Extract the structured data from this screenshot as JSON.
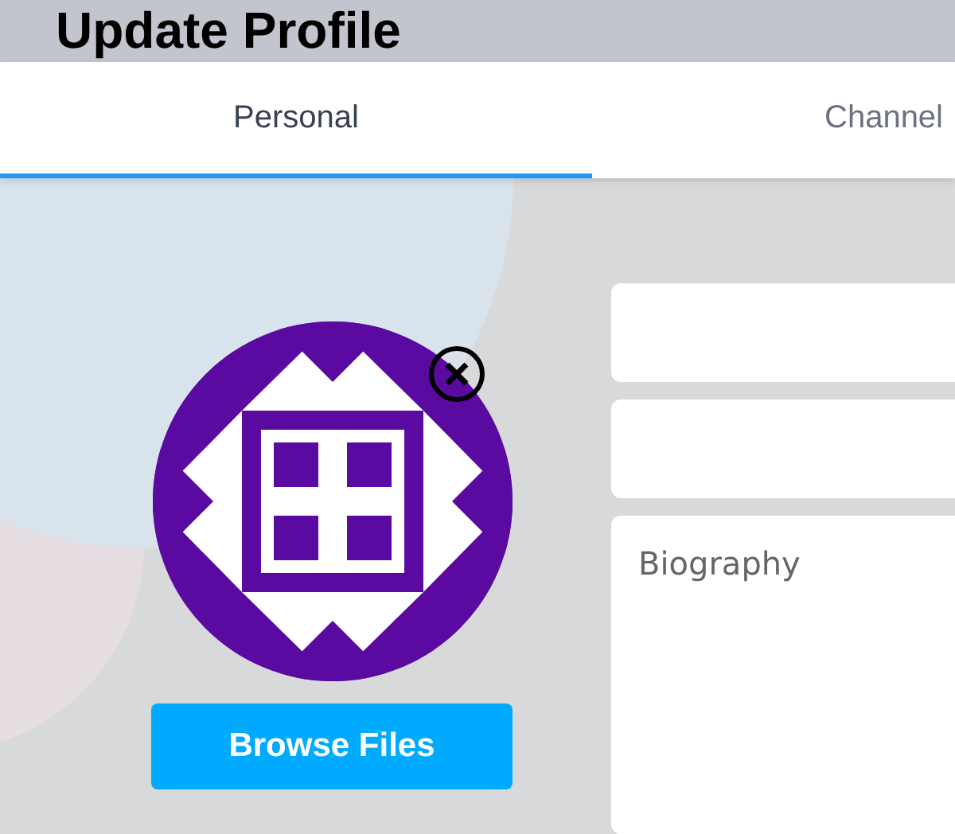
{
  "header": {
    "title": "Update Profile"
  },
  "tabs": [
    {
      "label": "Personal",
      "selected": true
    },
    {
      "label": "Channel",
      "selected": false
    }
  ],
  "fields": [
    {
      "kind": "input"
    },
    {
      "kind": "input"
    },
    {
      "kind": "textarea",
      "placeholder": "Biography"
    }
  ],
  "browse_button": {
    "label": "Browse Files"
  }
}
